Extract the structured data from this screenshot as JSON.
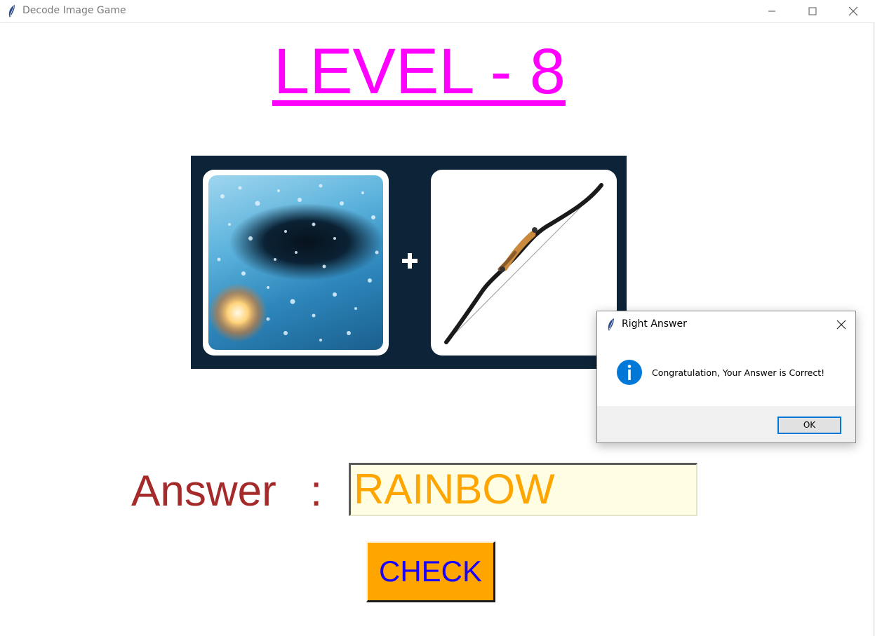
{
  "window": {
    "title": "Decode Image Game"
  },
  "level": {
    "title": "LEVEL - 8"
  },
  "puzzle": {
    "left_image": "rain-on-glass",
    "operator": "+",
    "right_image": "bow"
  },
  "answer": {
    "label": "Answer",
    "colon": ":",
    "value": "RAINBOW"
  },
  "check_button": {
    "label": "CHECK"
  },
  "dialog": {
    "title": "Right Answer",
    "message": "Congratulation, Your Answer is Correct!",
    "ok_label": "OK",
    "icon": "info-icon"
  },
  "colors": {
    "level_title": "#ff00ff",
    "answer_label": "#a52a2a",
    "answer_text": "#ffa500",
    "answer_bg": "#fffde2",
    "check_bg": "#ffa500",
    "check_text": "#1a00ff",
    "puzzle_bg": "#0d2438",
    "info_blue": "#0078d7"
  }
}
